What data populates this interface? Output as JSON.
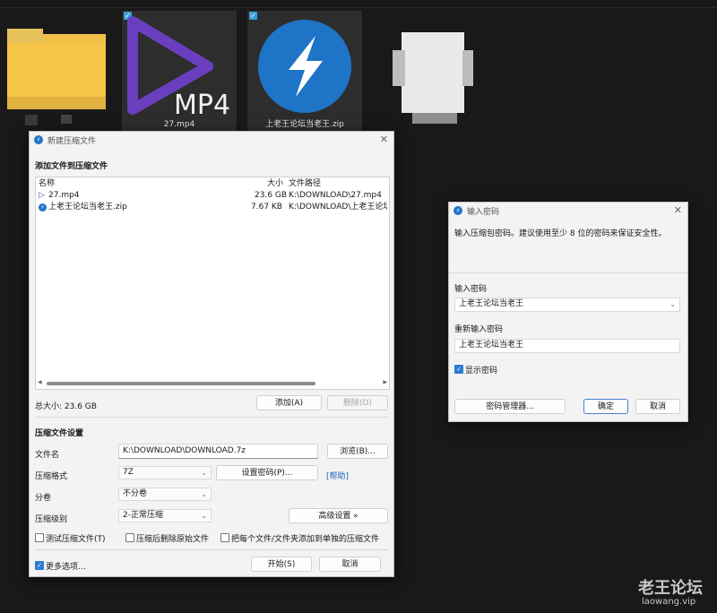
{
  "desktop": {
    "tiles": [
      {
        "caption": ""
      },
      {
        "caption": "27.mp4",
        "badge": "MP4"
      },
      {
        "caption": "上老王论坛当老王.zip"
      },
      {
        "caption": ""
      }
    ]
  },
  "archive_dialog": {
    "title": "新建压缩文件",
    "section_add": "添加文件到压缩文件",
    "columns": {
      "name": "名称",
      "size": "大小",
      "path": "文件路径"
    },
    "files": [
      {
        "name": "27.mp4",
        "size": "23.6 GB",
        "path": "K:\\DOWNLOAD\\27.mp4",
        "icon": "video-file-icon"
      },
      {
        "name": "上老王论坛当老王.zip",
        "size": "7.67 KB",
        "path": "K:\\DOWNLOAD\\上老王论坛",
        "icon": "zip-file-icon"
      }
    ],
    "total_size": "总大小: 23.6 GB",
    "add_button": "添加(A)",
    "delete_button": "删除(D)",
    "section_settings": "压缩文件设置",
    "filename_label": "文件名",
    "filename_value": "K:\\DOWNLOAD\\DOWNLOAD.7z",
    "browse_button": "浏览(B)...",
    "format_label": "压缩格式",
    "format_value": "7Z",
    "set_password_button": "设置密码(P)...",
    "help_link": "[帮助]",
    "split_label": "分卷",
    "split_value": "不分卷",
    "level_label": "压缩级别",
    "level_value": "2-正常压缩",
    "advanced_button": "高级设置 »",
    "test_checkbox": "测试压缩文件(T)",
    "delete_source_checkbox": "压缩后删除原始文件",
    "separate_checkbox": "把每个文件/文件夹添加到单独的压缩文件",
    "more_options": "更多选项...",
    "start_button": "开始(S)",
    "cancel_button": "取消"
  },
  "password_dialog": {
    "title": "输入密码",
    "description": "输入压缩包密码。建议使用至少 8 位的密码来保证安全性。",
    "password_label": "输入密码",
    "password_value": "上老王论坛当老王",
    "confirm_label": "重新输入密码",
    "confirm_value": "上老王论坛当老王",
    "show_password": "显示密码",
    "manager_button": "密码管理器...",
    "ok_button": "确定",
    "cancel_button": "取消"
  },
  "watermark": {
    "title": "老王论坛",
    "url": "laowang.vip"
  },
  "colors": {
    "accent": "#2d7bd1",
    "desktop_bg": "#191919",
    "dialog_bg": "#f3f3f3",
    "mp4_purple": "#6a3fbf",
    "zip_blue": "#1e74c7"
  }
}
